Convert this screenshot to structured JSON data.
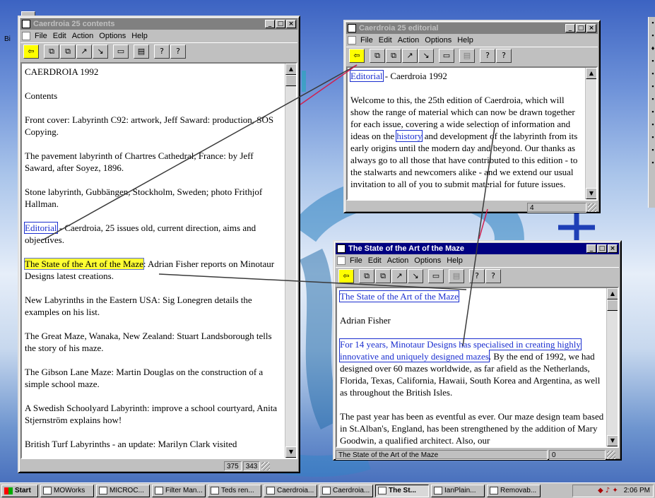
{
  "desktop": {
    "label": "Bi"
  },
  "menu": [
    "File",
    "Edit",
    "Action",
    "Options",
    "Help"
  ],
  "toolbar_icons": [
    "back-arrow-icon",
    "copy-icon",
    "copy-link-icon",
    "link-icon",
    "unlink-icon",
    "open-folder-icon",
    "document-icon",
    "help-icon",
    "context-help-icon"
  ],
  "window_controls": {
    "minimize": "_",
    "maximize": "□",
    "close": "×"
  },
  "contents": {
    "title": "Caerdroia 25 contents",
    "paragraphs": [
      "CAERDROIA 1992",
      "Contents",
      "Front cover: Labyrinth C92: artwork, Jeff Saward: production, SOS Copying.",
      "The pavement labyrinth of Chartres Cathedral, France: by Jeff Saward, after Soyez, 1896.",
      "Stone labyrinth, Gubbängen, Stockholm, Sweden; photo Frithjof Hallman."
    ],
    "editorial_link": "Editorial",
    "editorial_rest": " - Caerdroia, 25 issues old, current direction, aims and objectives.",
    "maze_link": "The State of the Art of the Maze",
    "maze_rest": ": Adrian Fisher reports on Minotaur Designs latest creations.",
    "paragraphs2": [
      "New Labyrinths in the Eastern USA: Sig Lonegren details the examples on his list.",
      "The Great Maze, Wanaka, New Zealand: Stuart Landsborough tells the story of his maze.",
      "The Gibson Lane Maze: Martin Douglas on the construction of a simple school maze.",
      "A Swedish Schoolyard Labyrinth: improve a school courtyard, Anita Stjernström explains how!",
      "British Turf Labyrinths - an update: Marilyn Clark visited"
    ],
    "status": [
      "375",
      "343"
    ]
  },
  "editorial": {
    "title": "Caerdroia 25 editorial",
    "heading_link": "Editorial",
    "heading_rest": " - Caerdroia 1992",
    "body_before": "Welcome to this, the 25th edition of Caerdroia, which will show the range of material which can now be drawn together for each issue, covering a wide selection of information and ideas on the ",
    "body_link": "history",
    "body_after": " and development of the labyrinth from its early origins until the modern day and beyond. Our thanks as always go to all those that have contributed to this edition - to the stalwarts and newcomers alike - and we extend our usual invitation to all of you to submit material for future issues.",
    "status": [
      "4"
    ]
  },
  "maze": {
    "title": "The State of the Art of the Maze",
    "heading_link": "The State of the Art of the Maze",
    "author": "Adrian Fisher",
    "lead_link": "For 14 years, Minotaur Designs has specialised in creating highly innovative and uniquely designed mazes",
    "lead_rest": ". By the end of 1992, we had designed over 60 mazes worldwide, as far afield as the Netherlands, Florida, Texas, California, Hawaii, South Korea and Argentina, as well as throughout the British Isles.",
    "para2": "The past year has been as eventful as ever. Our maze design team based in St.Alban's, England, has been strengthened by the addition of Mary Goodwin, a qualified architect. Also, our",
    "status": [
      "The State of the Art of the Maze",
      "0"
    ]
  },
  "taskbar": {
    "start": "Start",
    "tasks": [
      "MOWorks",
      "MICROC...",
      "Filter Man...",
      "Teds ren...",
      "Caerdroia...",
      "Caerdroia...",
      "The St...",
      "IanPlain...",
      "Removab..."
    ],
    "clock": "2:06 PM"
  }
}
